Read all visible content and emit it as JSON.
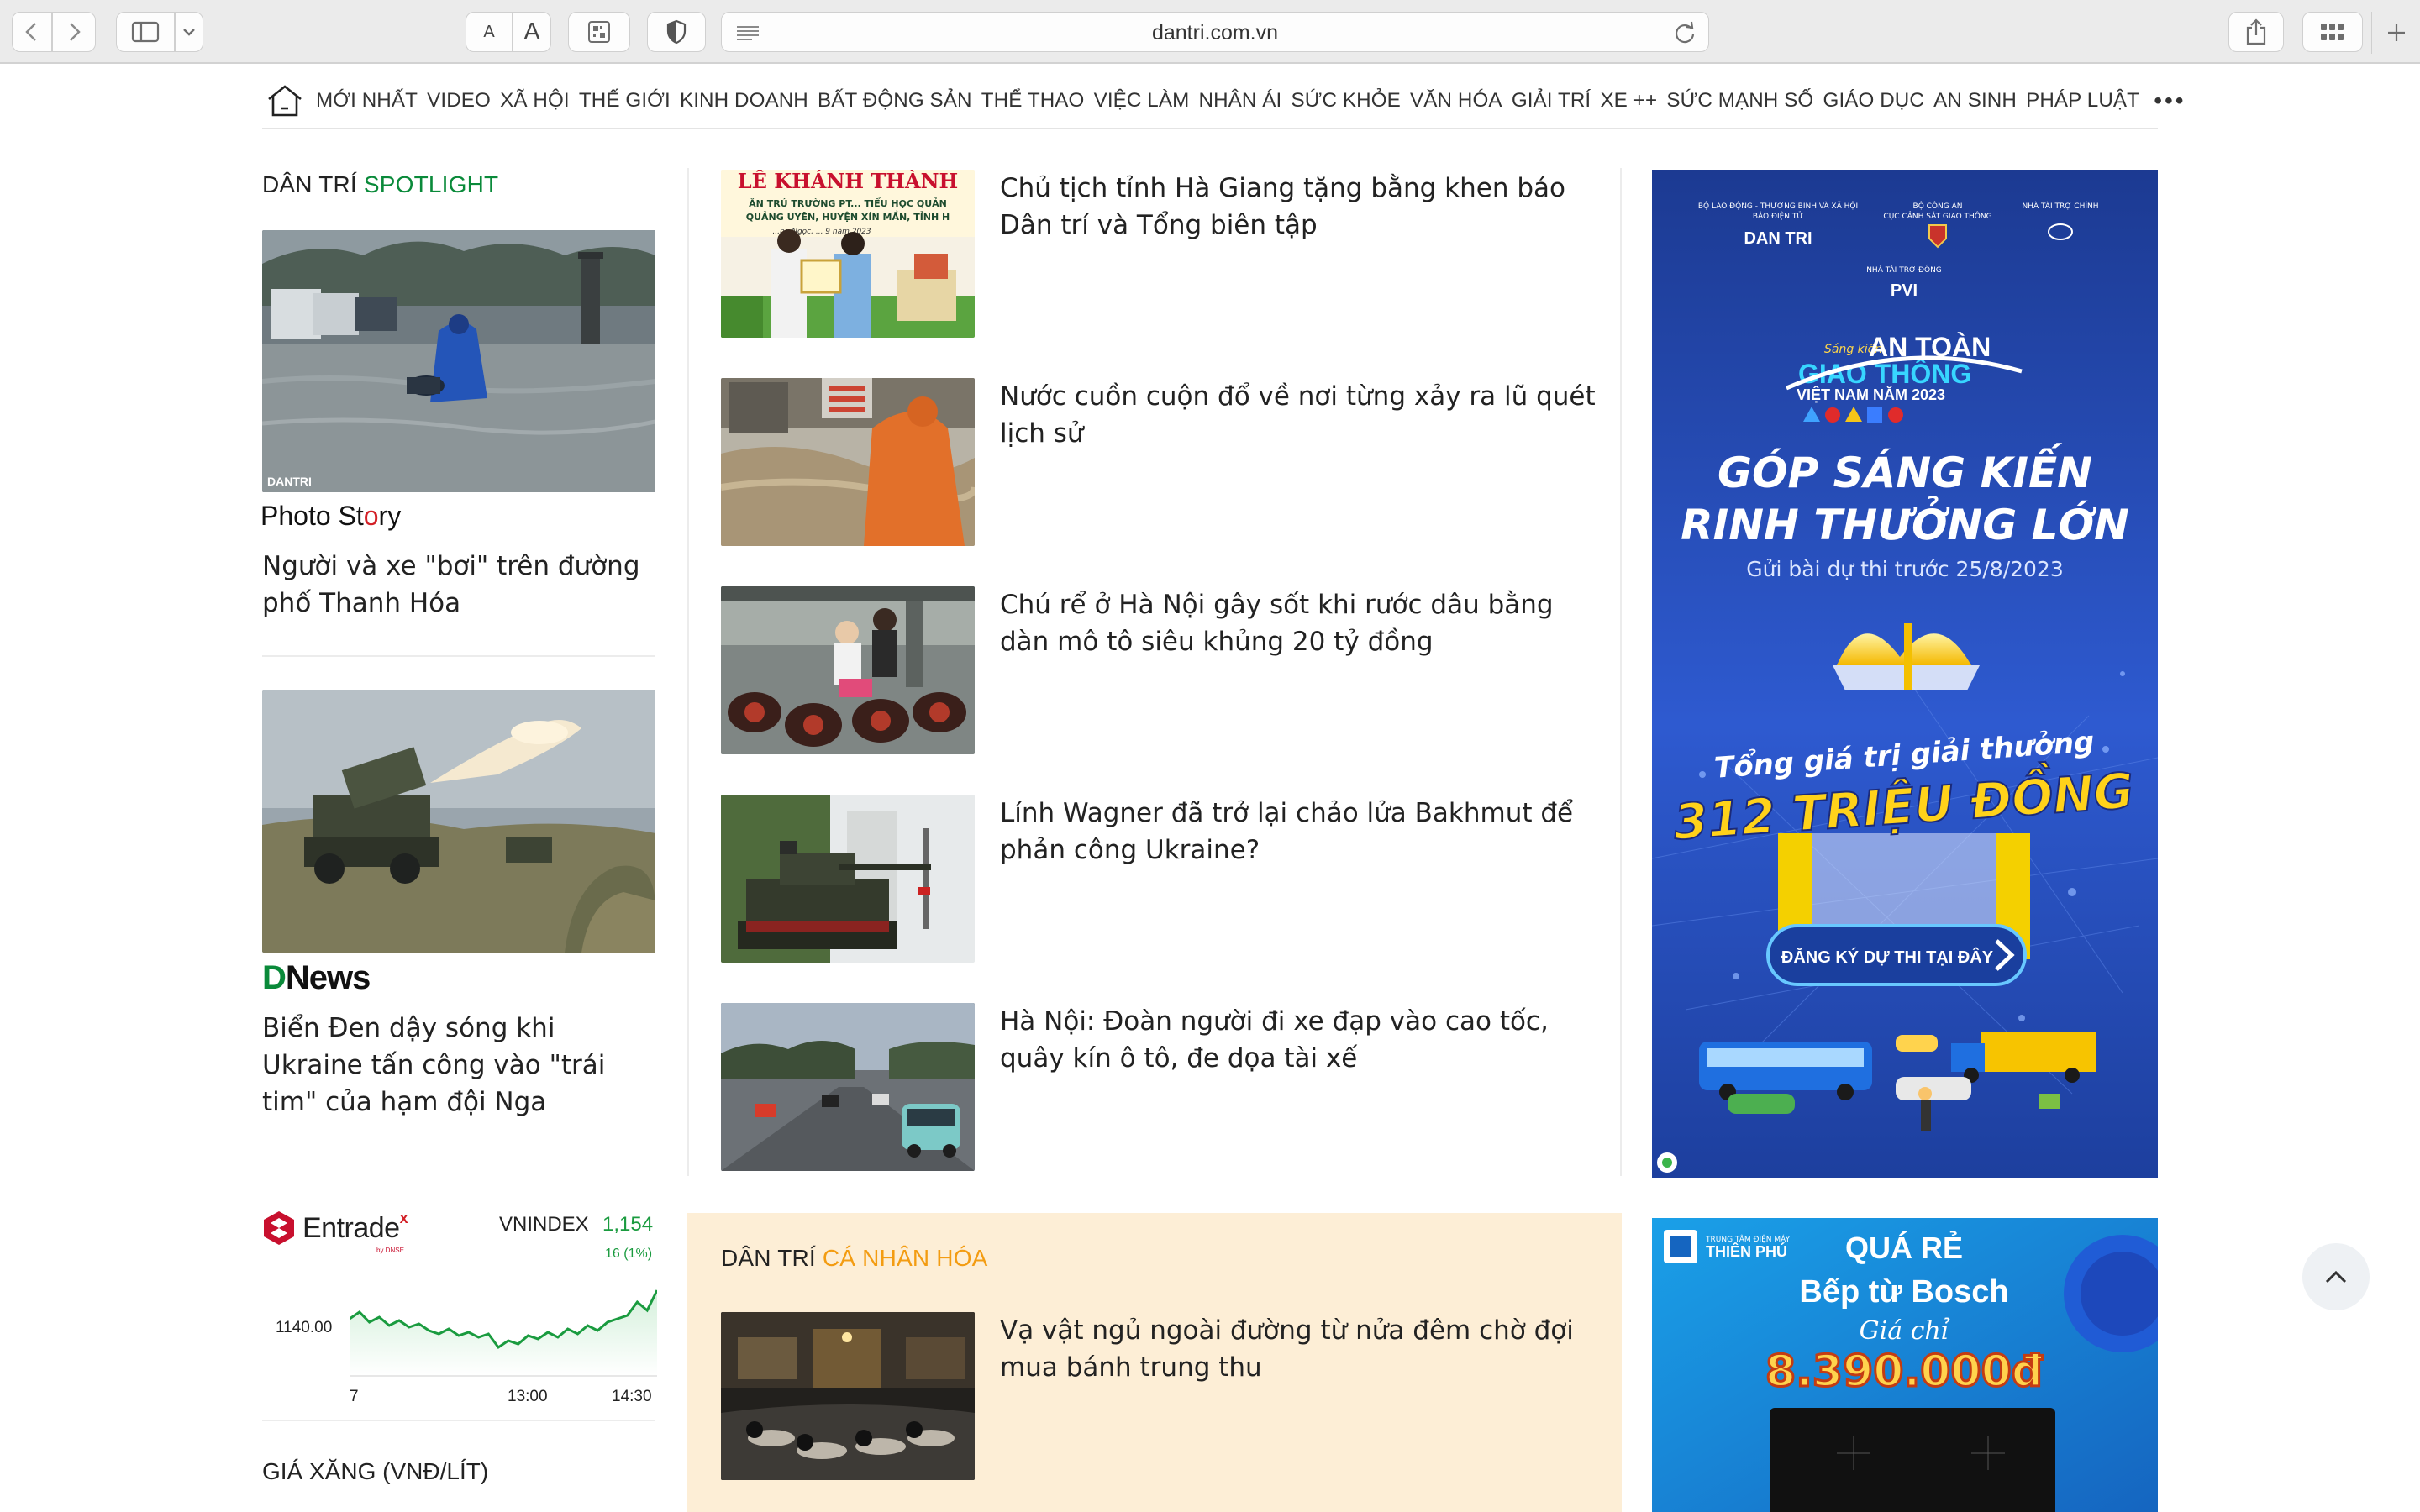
{
  "browser": {
    "url": "dantri.com.vn",
    "text_small_label": "A",
    "text_large_label": "A"
  },
  "nav": {
    "items": [
      "MỚI NHẤT",
      "VIDEO",
      "XÃ HỘI",
      "THẾ GIỚI",
      "KINH DOANH",
      "BẤT ĐỘNG SẢN",
      "THỂ THAO",
      "VIỆC LÀM",
      "NHÂN ÁI",
      "SỨC KHỎE",
      "VĂN HÓA",
      "GIẢI TRÍ",
      "XE ++",
      "SỨC MẠNH SỐ",
      "GIÁO DỤC",
      "AN SINH",
      "PHÁP LUẬT"
    ],
    "more": "•••"
  },
  "spotlight": {
    "heading_prefix": "DÂN TRÍ ",
    "heading_accent": "SPOTLIGHT",
    "photo_story_brand_a": "Photo St",
    "photo_story_brand_o": "o",
    "photo_story_brand_b": "ry",
    "story1_title": "Người và xe \"bơi\" trên đường phố Thanh Hóa",
    "image_watermark": "DANTRI",
    "dnews_d": "D",
    "dnews_rest": "News",
    "story2_title": "Biển Đen dậy sóng khi Ukraine tấn công vào \"trái tim\" của hạm đội Nga"
  },
  "main_news": [
    {
      "title": "Chủ tịch tỉnh Hà Giang tặng bằng khen báo Dân trí và Tổng biên tập",
      "img_caption_top": "LÊ KHÁNH THÀNH",
      "img_caption_lines": [
        "ĂN TRÚ TRƯỜNG PT... TIỂU HỌC QUẢN",
        "QUẢNG UYÊN, HUYỆN XÍN MẦN, TỈNH H",
        "...ng Ngọc, ... 9 năm 2023"
      ]
    },
    {
      "title": "Nước cuồn cuộn đổ về nơi từng xảy ra lũ quét lịch sử"
    },
    {
      "title": "Chú rể ở Hà Nội gây sốt khi rước dâu bằng dàn mô tô siêu khủng 20 tỷ đồng"
    },
    {
      "title": "Lính Wagner đã trở lại chảo lửa Bakhmut để phản công Ukraine?"
    },
    {
      "title": "Hà Nội: Đoàn người đi xe đạp vào cao tốc, quây kín ô tô, đe dọa tài xế"
    }
  ],
  "ad_traffic": {
    "sponsor1_line1": "BỘ LAO ĐỘNG - THƯƠNG BINH VÀ XÃ HỘI",
    "sponsor1_line2": "BÁO ĐIỆN TỬ",
    "sponsor1_logo": "DAN TRI",
    "sponsor2_line1": "BỘ CÔNG AN",
    "sponsor2_line2": "CỤC CẢNH SÁT GIAO THÔNG",
    "sponsor3_line1": "NHÀ TÀI TRỢ CHÍNH",
    "cosponsor_label": "NHÀ TÀI TRỢ ĐỒNG",
    "cosponsor_logo": "PVI",
    "contest_small": "Sáng kiến",
    "contest_line1": "AN TOÀN",
    "contest_line2": "GIAO THÔNG",
    "contest_line3": "VIỆT NAM NĂM 2023",
    "headline1": "GÓP SÁNG KIẾN",
    "headline2": "RINH THƯỞNG LỚN",
    "deadline": "Gửi bài dự thi trước 25/8/2023",
    "prize_label": "Tổng giá trị giải thưởng",
    "prize_value": "312 TRIỆU ĐỒNG",
    "cta": "ĐĂNG KÝ DỰ THI TẠI ĐÂY"
  },
  "stock": {
    "brand": "Entrade",
    "brand_sup": "x",
    "brand_sub": "by DNSE",
    "index_name": "VNINDEX",
    "index_value": "1,154",
    "index_change": "16 (1%)",
    "y_label": "1140.00",
    "x_labels": [
      "7",
      "13:00",
      "14:30"
    ]
  },
  "fuel": {
    "title": "GIÁ XĂNG (VNĐ/LÍT)"
  },
  "personal": {
    "heading_prefix": "DÂN TRÍ ",
    "heading_accent": "CÁ NHÂN HÓA",
    "item_title": "Vạ vật ngủ ngoài đường từ nửa đêm chờ đợi mua bánh trung thu"
  },
  "ad_bosch": {
    "store_name": "THIÊN PHÚ",
    "store_sub": "TRUNG TÂM ĐIỆN MÁY",
    "line1": "QUÁ RẺ",
    "line2": "Bếp từ Bosch",
    "line3": "Giá chỉ",
    "price": "8.390.000đ"
  },
  "colors": {
    "brand_green": "#0a8a3a",
    "accent_orange": "#f39c12",
    "ad_blue": "#1b3f9c",
    "personal_bg": "#fdeed6",
    "stock_green": "#1a9b3f"
  }
}
